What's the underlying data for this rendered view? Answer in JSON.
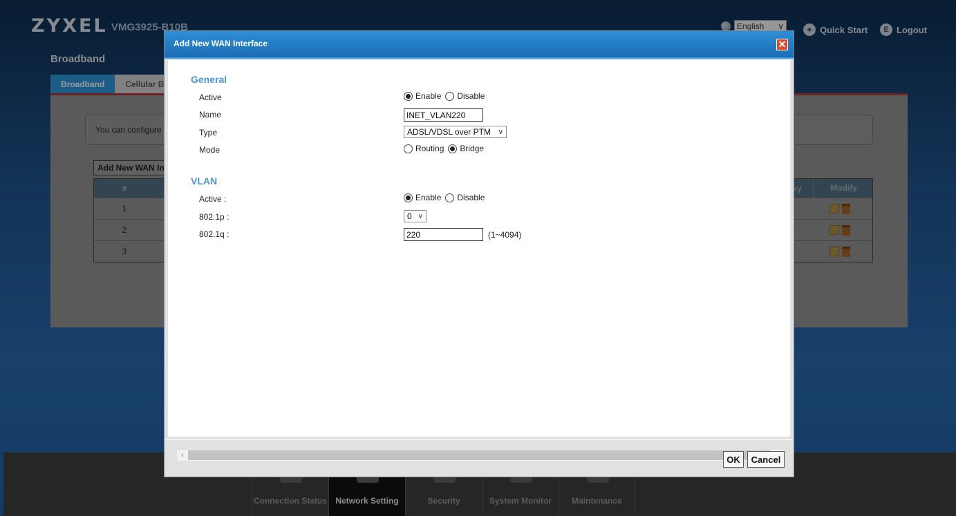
{
  "header": {
    "logo": "ZYXEL",
    "model": "VMG3925-B10B",
    "language": "English",
    "quick_start": "Quick Start",
    "logout": "Logout"
  },
  "background": {
    "title": "Broadband",
    "tabs": [
      {
        "label": "Broadband",
        "active": true
      },
      {
        "label": "Cellular B",
        "active": false
      }
    ],
    "note": "You can configure",
    "add_button": "Add New WAN In",
    "table": {
      "col_num": "#",
      "col_proxy": "oxy",
      "col_modify": "Modify",
      "rows": [
        "1",
        "2",
        "3"
      ]
    }
  },
  "bottom_nav": [
    {
      "label": "Connection Status",
      "active": false
    },
    {
      "label": "Network Setting",
      "active": true
    },
    {
      "label": "Security",
      "active": false
    },
    {
      "label": "System Monitor",
      "active": false
    },
    {
      "label": "Maintenance",
      "active": false
    }
  ],
  "dialog": {
    "title": "Add New WAN Interface",
    "general": {
      "section": "General",
      "active_label": "Active",
      "active_options": [
        "Enable",
        "Disable"
      ],
      "active_value": "Enable",
      "name_label": "Name",
      "name_value": "INET_VLAN220",
      "type_label": "Type",
      "type_value": "ADSL/VDSL over PTM",
      "mode_label": "Mode",
      "mode_options": [
        "Routing",
        "Bridge"
      ],
      "mode_value": "Bridge"
    },
    "vlan": {
      "section": "VLAN",
      "active_label": "Active :",
      "active_options": [
        "Enable",
        "Disable"
      ],
      "active_value": "Enable",
      "p_label": "802.1p :",
      "p_value": "0",
      "q_label": "802.1q :",
      "q_value": "220",
      "q_hint": "(1~4094)"
    },
    "ok": "OK",
    "cancel": "Cancel"
  },
  "colors": {
    "dialog_header": "#1b6db5",
    "section_title": "#4e95d8",
    "close_button": "#e24a2c"
  }
}
